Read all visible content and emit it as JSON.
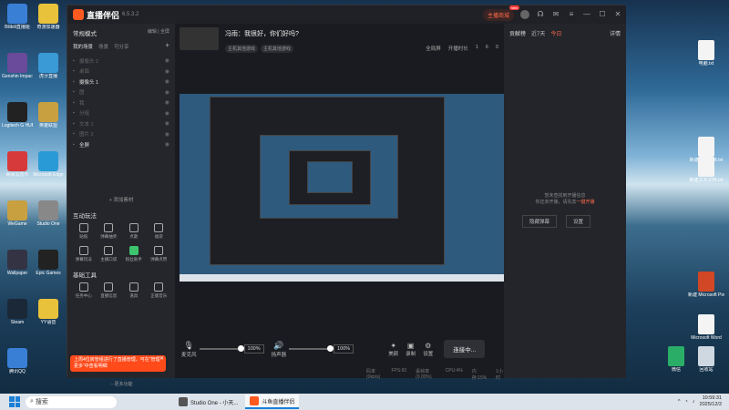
{
  "desktop": {
    "left_icons": [
      {
        "label": "Bilibili直播姬",
        "color": "#3a7fd6"
      },
      {
        "label": "奇游加速器",
        "color": "#e8c23a"
      },
      {
        "label": "Genshin Impact",
        "color": "#6a4a9a"
      },
      {
        "label": "虎牙直播",
        "color": "#3a9ad6"
      },
      {
        "label": "Logitech G HUB",
        "color": "#222"
      },
      {
        "label": "英雄联盟",
        "color": "#c8a040"
      },
      {
        "label": "网易云音乐",
        "color": "#d63a3a"
      },
      {
        "label": "Microsoft Edge",
        "color": "#2a9ad6"
      },
      {
        "label": "WeGame",
        "color": "#c8a040"
      },
      {
        "label": "Studio One",
        "color": "#888"
      },
      {
        "label": "Wallpaper",
        "color": "#334"
      },
      {
        "label": "Epic Games",
        "color": "#222"
      },
      {
        "label": "Steam",
        "color": "#1b2838"
      },
      {
        "label": "YY语音",
        "color": "#e8c23a"
      },
      {
        "label": "腾讯QQ",
        "color": "#3a7fd6"
      }
    ],
    "right_icons": [
      {
        "label": "电脑.txt",
        "color": "#f4f4f4"
      },
      {
        "label": "新建文本文档.txt",
        "color": "#f4f4f4"
      },
      {
        "label": "新建文本文档.txt",
        "color": "#f4f4f4"
      },
      {
        "label": "新建 Microsoft PowerPoint",
        "color": "#d24726"
      },
      {
        "label": "Microsoft Word",
        "color": "#f4f4f4"
      },
      {
        "label": "微信",
        "color": "#2aae67"
      },
      {
        "label": "回收站",
        "color": "#cfd8e0"
      }
    ]
  },
  "app": {
    "name": "直播伴侣",
    "version": "6.5.3.2",
    "live_pill": "主播商城",
    "pill_badge": "new",
    "window_controls": [
      "settings-icon",
      "minimize-icon",
      "maximize-icon",
      "close-icon"
    ],
    "left": {
      "mode": "常规模式",
      "mode_links": "编辑 | 全屏",
      "tabs": [
        "我的场景",
        "场景",
        "可分享"
      ],
      "sources": [
        {
          "label": "摄像头 2",
          "active": false
        },
        {
          "label": "桌面",
          "active": false
        },
        {
          "label": "摄像头 1",
          "active": true
        },
        {
          "label": "图",
          "active": false
        },
        {
          "label": "我",
          "active": false
        },
        {
          "label": "分组",
          "active": false
        },
        {
          "label": "文本 1",
          "active": false
        },
        {
          "label": "图片 2",
          "active": false
        },
        {
          "label": "全屏",
          "active": true
        }
      ],
      "add_source": "+ 添加素材",
      "section1": "互动玩法",
      "tools1": [
        "贴纸",
        "弹幕抽奖",
        "点歌",
        "福袋",
        "弹幕玩法",
        "主播口袋",
        "粉丝助手",
        "弹幕点赞"
      ],
      "section2": "基础工具",
      "tools2": [
        "任务中心",
        "直播信息",
        "道具",
        "正版音乐"
      ],
      "toast": "上周4位房管组进行了直播管理，可在“管理更多”中查看明细",
      "more": "···更多功能"
    },
    "center": {
      "title": "冯雨：我很好，你们好吗?",
      "tags": [
        "主机其他游戏",
        "主机其他游戏"
      ],
      "stats": [
        "全局屏",
        "开播时长",
        "1",
        "6",
        "0"
      ],
      "mic_label": "麦克风",
      "mic_pct": "100%",
      "spk_label": "扬声器",
      "spk_pct": "100%",
      "controls": [
        "美颜",
        "录制",
        "设置"
      ],
      "live_button": "连接中...",
      "status": [
        "码率(0kb/s)",
        "FPS:60",
        "丢帧率(0.00%)",
        "CPU:4%",
        "内存:15%",
        "1小时"
      ]
    },
    "right": {
      "tabs": [
        "贡献榜",
        "近7天",
        "今日",
        "详情"
      ],
      "message_line1": "暂未查找到开播信息",
      "message_line2": "你还未开播，请先去",
      "message_link": "一键开播",
      "buttons": [
        "隐藏弹幕",
        "设置"
      ]
    }
  },
  "taskbar": {
    "search": "搜索",
    "apps": [
      {
        "label": "Studio One - 小天...",
        "color": "#555",
        "active": false
      },
      {
        "label": "斗鱼直播伴侣",
        "color": "#ff5a1f",
        "active": true
      }
    ],
    "time": "10:59:31",
    "date": "2025/12/2"
  }
}
